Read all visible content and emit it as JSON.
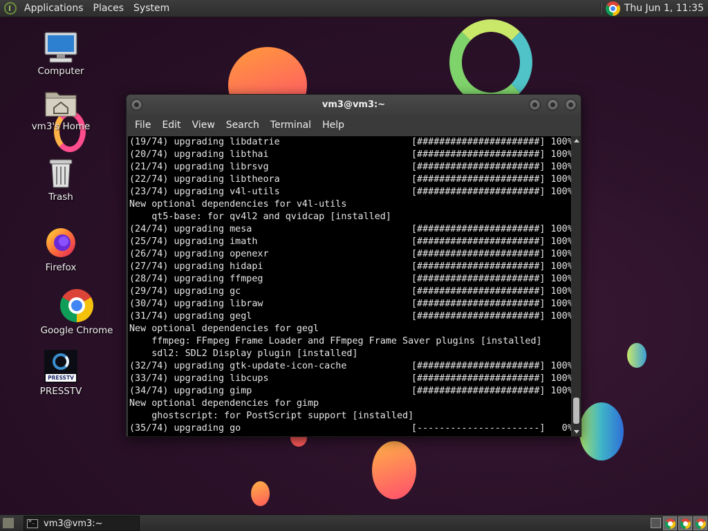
{
  "top_panel": {
    "menus": [
      "Applications",
      "Places",
      "System"
    ],
    "clock": "Thu Jun  1, 11:35"
  },
  "desktop": {
    "icons": [
      {
        "label": "Computer",
        "icon": "computer-icon"
      },
      {
        "label": "vm3's Home",
        "icon": "home-folder-icon"
      },
      {
        "label": "Trash",
        "icon": "trash-icon"
      },
      {
        "label": "Firefox",
        "icon": "firefox-icon"
      },
      {
        "label": "Google Chrome",
        "icon": "chrome-icon"
      },
      {
        "label": "PRESSTV",
        "icon": "presstv-icon",
        "badge": "PRESSTV"
      }
    ]
  },
  "terminal": {
    "title": "vm3@vm3:~",
    "menus": [
      "File",
      "Edit",
      "View",
      "Search",
      "Terminal",
      "Help"
    ],
    "lines": [
      {
        "text": "(19/74) upgrading libdatrie",
        "bar": "[######################] 100%"
      },
      {
        "text": "(20/74) upgrading libthai",
        "bar": "[######################] 100%"
      },
      {
        "text": "(21/74) upgrading librsvg",
        "bar": "[######################] 100%"
      },
      {
        "text": "(22/74) upgrading libtheora",
        "bar": "[######################] 100%"
      },
      {
        "text": "(23/74) upgrading v4l-utils",
        "bar": "[######################] 100%"
      },
      {
        "text": "New optional dependencies for v4l-utils",
        "bar": ""
      },
      {
        "text": "    qt5-base: for qv4l2 and qvidcap [installed]",
        "bar": ""
      },
      {
        "text": "(24/74) upgrading mesa",
        "bar": "[######################] 100%"
      },
      {
        "text": "(25/74) upgrading imath",
        "bar": "[######################] 100%"
      },
      {
        "text": "(26/74) upgrading openexr",
        "bar": "[######################] 100%"
      },
      {
        "text": "(27/74) upgrading hidapi",
        "bar": "[######################] 100%"
      },
      {
        "text": "(28/74) upgrading ffmpeg",
        "bar": "[######################] 100%"
      },
      {
        "text": "(29/74) upgrading gc",
        "bar": "[######################] 100%"
      },
      {
        "text": "(30/74) upgrading libraw",
        "bar": "[######################] 100%"
      },
      {
        "text": "(31/74) upgrading gegl",
        "bar": "[######################] 100%"
      },
      {
        "text": "New optional dependencies for gegl",
        "bar": ""
      },
      {
        "text": "    ffmpeg: FFmpeg Frame Loader and FFmpeg Frame Saver plugins [installed]",
        "bar": ""
      },
      {
        "text": "    sdl2: SDL2 Display plugin [installed]",
        "bar": ""
      },
      {
        "text": "(32/74) upgrading gtk-update-icon-cache",
        "bar": "[######################] 100%"
      },
      {
        "text": "(33/74) upgrading libcups",
        "bar": "[######################] 100%"
      },
      {
        "text": "(34/74) upgrading gimp",
        "bar": "[######################] 100%"
      },
      {
        "text": "New optional dependencies for gimp",
        "bar": ""
      },
      {
        "text": "    ghostscript: for PostScript support [installed]",
        "bar": ""
      },
      {
        "text": "(35/74) upgrading go",
        "bar": "[----------------------]   0%"
      }
    ]
  },
  "bottom_panel": {
    "task_label": "vm3@vm3:~"
  },
  "colors": {
    "desktop_bg": "#2a1228",
    "terminal_bg": "#000000",
    "terminal_fg": "#e6e6e6",
    "panel_bg": "#333333"
  }
}
